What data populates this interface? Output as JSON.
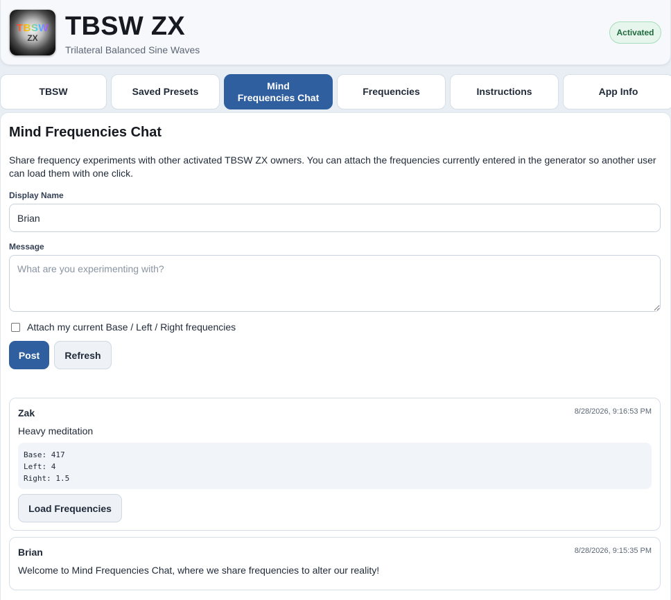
{
  "header": {
    "logo_line1": "TBSW",
    "logo_line2": "ZX",
    "title": "TBSW ZX",
    "subtitle": "Trilateral Balanced Sine Waves",
    "status": "Activated"
  },
  "tabs": [
    {
      "label": "TBSW",
      "active": false
    },
    {
      "label": "Saved Presets",
      "active": false
    },
    {
      "label": "Mind Frequencies Chat",
      "active": true
    },
    {
      "label": "Frequencies",
      "active": false
    },
    {
      "label": "Instructions",
      "active": false
    },
    {
      "label": "App Info",
      "active": false
    }
  ],
  "chat": {
    "title": "Mind Frequencies Chat",
    "intro": "Share frequency experiments with other activated TBSW ZX owners. You can attach the frequencies currently entered in the generator so another user can load them with one click.",
    "display_name_label": "Display Name",
    "display_name_value": "Brian",
    "message_label": "Message",
    "message_placeholder": "What are you experimenting with?",
    "attach_label": "Attach my current Base / Left / Right frequencies",
    "attach_checked": false,
    "post_button": "Post",
    "refresh_button": "Refresh"
  },
  "posts": [
    {
      "author": "Zak",
      "time": "8/28/2026, 9:16:53 PM",
      "message": "Heavy meditation",
      "freq_base": "Base: 417",
      "freq_left": "Left: 4",
      "freq_right": "Right: 1.5",
      "load_button": "Load Frequencies"
    },
    {
      "author": "Brian",
      "time": "8/28/2026, 9:15:35 PM",
      "message": "Welcome to Mind Frequencies Chat, where we share frequencies to alter our reality!"
    }
  ],
  "colors": {
    "accent": "#2f5f9e",
    "activated_bg": "#e6f6ec",
    "activated_text": "#1f6b3d"
  }
}
